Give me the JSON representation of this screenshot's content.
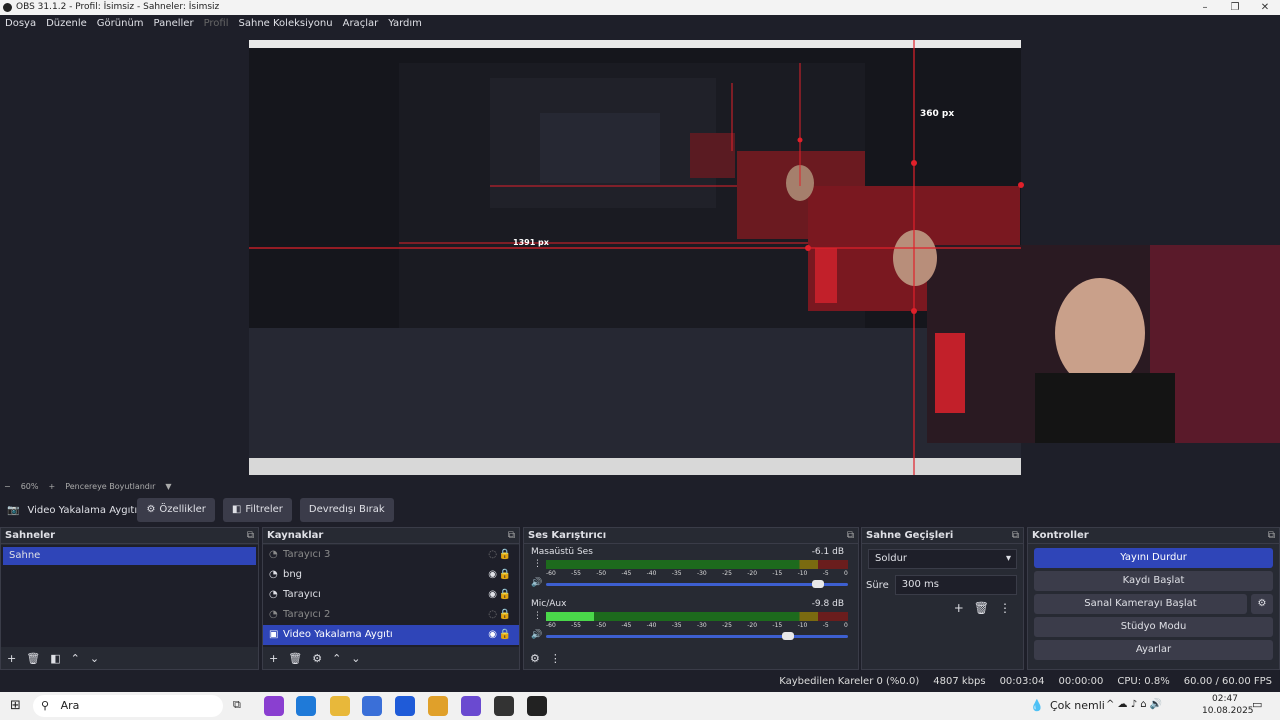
{
  "window": {
    "title": "OBS 31.1.2 - Profil: İsimsiz - Sahneler: İsimsiz"
  },
  "menu": [
    "Dosya",
    "Düzenle",
    "Görünüm",
    "Paneller",
    "Profil",
    "Sahne Koleksiyonu",
    "Araçlar",
    "Yardım"
  ],
  "preview": {
    "label_360": "360 px",
    "label_1391": "1391 px"
  },
  "zoom": {
    "minus": "−",
    "value": "60%",
    "plus": "+",
    "fit": "Pencereye Boyutlandır",
    "caret": "▼"
  },
  "source_toolbar": {
    "name": "Video Yakalama Aygıtı",
    "properties": "Özellikler",
    "filters": "Filtreler",
    "deactivate": "Devredışı Bırak"
  },
  "scenes": {
    "title": "Sahneler",
    "items": [
      "Sahne"
    ]
  },
  "sources": {
    "title": "Kaynaklar",
    "items": [
      {
        "name": "Tarayıcı 3",
        "visible": false
      },
      {
        "name": "bng",
        "visible": true
      },
      {
        "name": "Tarayıcı",
        "visible": true
      },
      {
        "name": "Tarayıcı 2",
        "visible": false
      },
      {
        "name": "Video Yakalama Aygıtı",
        "visible": true,
        "selected": true
      }
    ]
  },
  "mixer": {
    "title": "Ses Karıştırıcı",
    "channels": [
      {
        "name": "Masaüstü Ses",
        "db": "-6.1 dB",
        "level": 0.0,
        "volume": 0.9
      },
      {
        "name": "Mic/Aux",
        "db": "-9.8 dB",
        "level": 0.16,
        "volume": 0.8
      }
    ],
    "scale": [
      "-60",
      "-55",
      "-50",
      "-45",
      "-40",
      "-35",
      "-30",
      "-25",
      "-20",
      "-15",
      "-10",
      "-5",
      "0"
    ]
  },
  "transitions": {
    "title": "Sahne Geçişleri",
    "selected": "Soldur",
    "duration_label": "Süre",
    "duration": "300 ms"
  },
  "controls": {
    "title": "Kontroller",
    "buttons": [
      "Yayını Durdur",
      "Kaydı Başlat",
      "Sanal Kamerayı Başlat",
      "Stüdyo Modu",
      "Ayarlar"
    ]
  },
  "status": {
    "dropped": "Kaybedilen Kareler 0 (%0.0)",
    "bitrate": "4807 kbps",
    "stream_time": "00:03:04",
    "rec_time": "00:00:00",
    "cpu": "CPU: 0.8%",
    "fps": "60.00 / 60.00 FPS"
  },
  "taskbar": {
    "search": "Ara",
    "weather": "Çok nemli",
    "time": "02:47",
    "date": "10.08.2025"
  },
  "colors": {
    "accent": "#2f45b8",
    "bg": "#1e1f29",
    "panel": "#272a33",
    "red": "#e0202a"
  }
}
